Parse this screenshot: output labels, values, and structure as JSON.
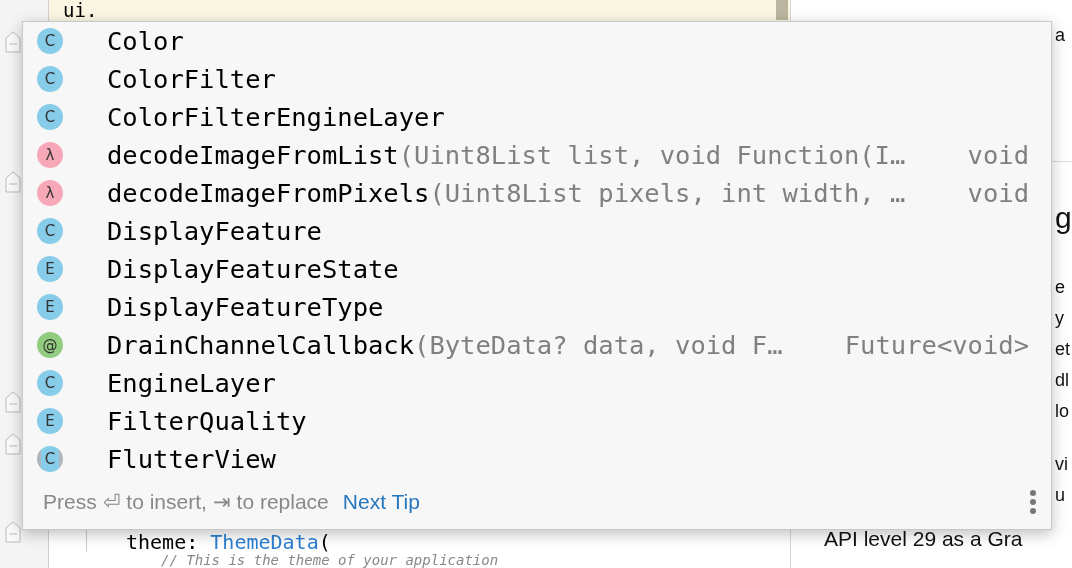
{
  "editor": {
    "top_line": "ui.",
    "bottom_lines": [
      {
        "kind": "code",
        "parts": [
          {
            "text": "theme: ",
            "kind": "plain"
          },
          {
            "text": "ThemeData",
            "kind": "type"
          },
          {
            "text": "(",
            "kind": "plain"
          }
        ]
      },
      {
        "kind": "comment",
        "parts": [
          {
            "text": "// This is the theme of your application",
            "kind": "comment"
          }
        ]
      }
    ]
  },
  "side_panel": {
    "blocks": [
      {
        "kind": "text",
        "lines": [
          "a"
        ]
      },
      {
        "kind": "heading",
        "lines": [
          "g"
        ]
      },
      {
        "kind": "text",
        "lines": [
          "e",
          "y",
          "et",
          "dl",
          "lo"
        ]
      },
      {
        "kind": "text",
        "lines": [
          "vi",
          "u"
        ]
      },
      {
        "kind": "full",
        "lines": [
          "API level 29 as a Gra"
        ]
      }
    ]
  },
  "completion_popup": {
    "items": [
      {
        "kind": "class",
        "badge": "C",
        "name": "Color"
      },
      {
        "kind": "class",
        "badge": "C",
        "name": "ColorFilter"
      },
      {
        "kind": "class",
        "badge": "C",
        "name": "ColorFilterEngineLayer"
      },
      {
        "kind": "function",
        "badge": "λ",
        "name": "decodeImageFromList",
        "params": "(Uint8List list, void Function(I…",
        "type": "void"
      },
      {
        "kind": "function",
        "badge": "λ",
        "name": "decodeImageFromPixels",
        "params": "(Uint8List pixels, int width, …",
        "type": "void"
      },
      {
        "kind": "class",
        "badge": "C",
        "name": "DisplayFeature"
      },
      {
        "kind": "enum",
        "badge": "E",
        "name": "DisplayFeatureState"
      },
      {
        "kind": "enum",
        "badge": "E",
        "name": "DisplayFeatureType"
      },
      {
        "kind": "typedef",
        "badge": "@",
        "name": "DrainChannelCallback",
        "params": "(ByteData? data, void F…",
        "type": "Future<void>"
      },
      {
        "kind": "class",
        "badge": "C",
        "name": "EngineLayer"
      },
      {
        "kind": "enum",
        "badge": "E",
        "name": "FilterQuality"
      },
      {
        "kind": "abstract-class",
        "badge": "C",
        "name": "FlutterView"
      }
    ],
    "hint": "Press ⏎ to insert, ⇥ to replace",
    "next_tip": "Next Tip"
  }
}
